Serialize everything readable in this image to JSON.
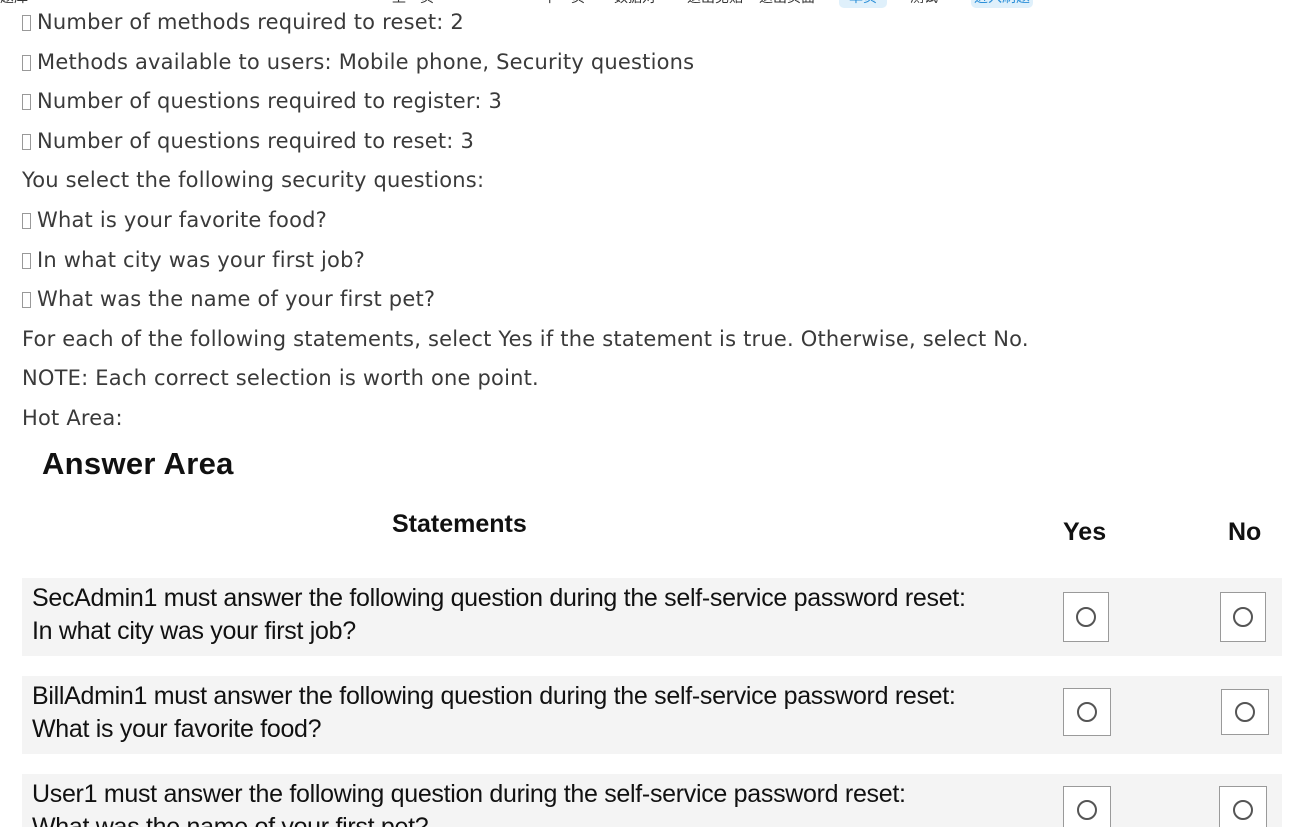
{
  "toolbar": {
    "items": [
      "题库",
      "上一页",
      "下一页",
      "数据对",
      "退出见贴",
      "退出页面",
      "单页",
      "测试",
      "进入刷题"
    ]
  },
  "question": {
    "lines": [
      "Number of methods required to reset: 2",
      "Methods available to users: Mobile phone, Security questions",
      "Number of questions required to register: 3",
      "Number of questions required to reset: 3",
      "You select the following security questions:",
      "What is your favorite food?",
      "In what city was your first job?",
      "What was the name of your first pet?",
      "For each of the following statements, select Yes if the statement is true. Otherwise, select No.",
      "NOTE: Each correct selection is worth one point.",
      "Hot Area:"
    ]
  },
  "answer_area": {
    "title": "Answer Area",
    "header_statements": "Statements",
    "header_yes": "Yes",
    "header_no": "No",
    "rows": [
      {
        "line1": "SecAdmin1 must answer the following question during the self-service password reset:",
        "line2": "In what city was your first job?"
      },
      {
        "line1": "BillAdmin1 must answer the following question during the self-service password reset:",
        "line2": "What is your favorite food?"
      },
      {
        "line1": "User1 must answer the following question during the self-service password reset:",
        "line2": "What was the name of your first pet?"
      }
    ]
  },
  "colors": {
    "text": "#3a3a3a",
    "accent_pill_bg": "#dff0fb",
    "accent_pill_text": "#2b8fd8",
    "row_bg": "#f4f4f4"
  }
}
